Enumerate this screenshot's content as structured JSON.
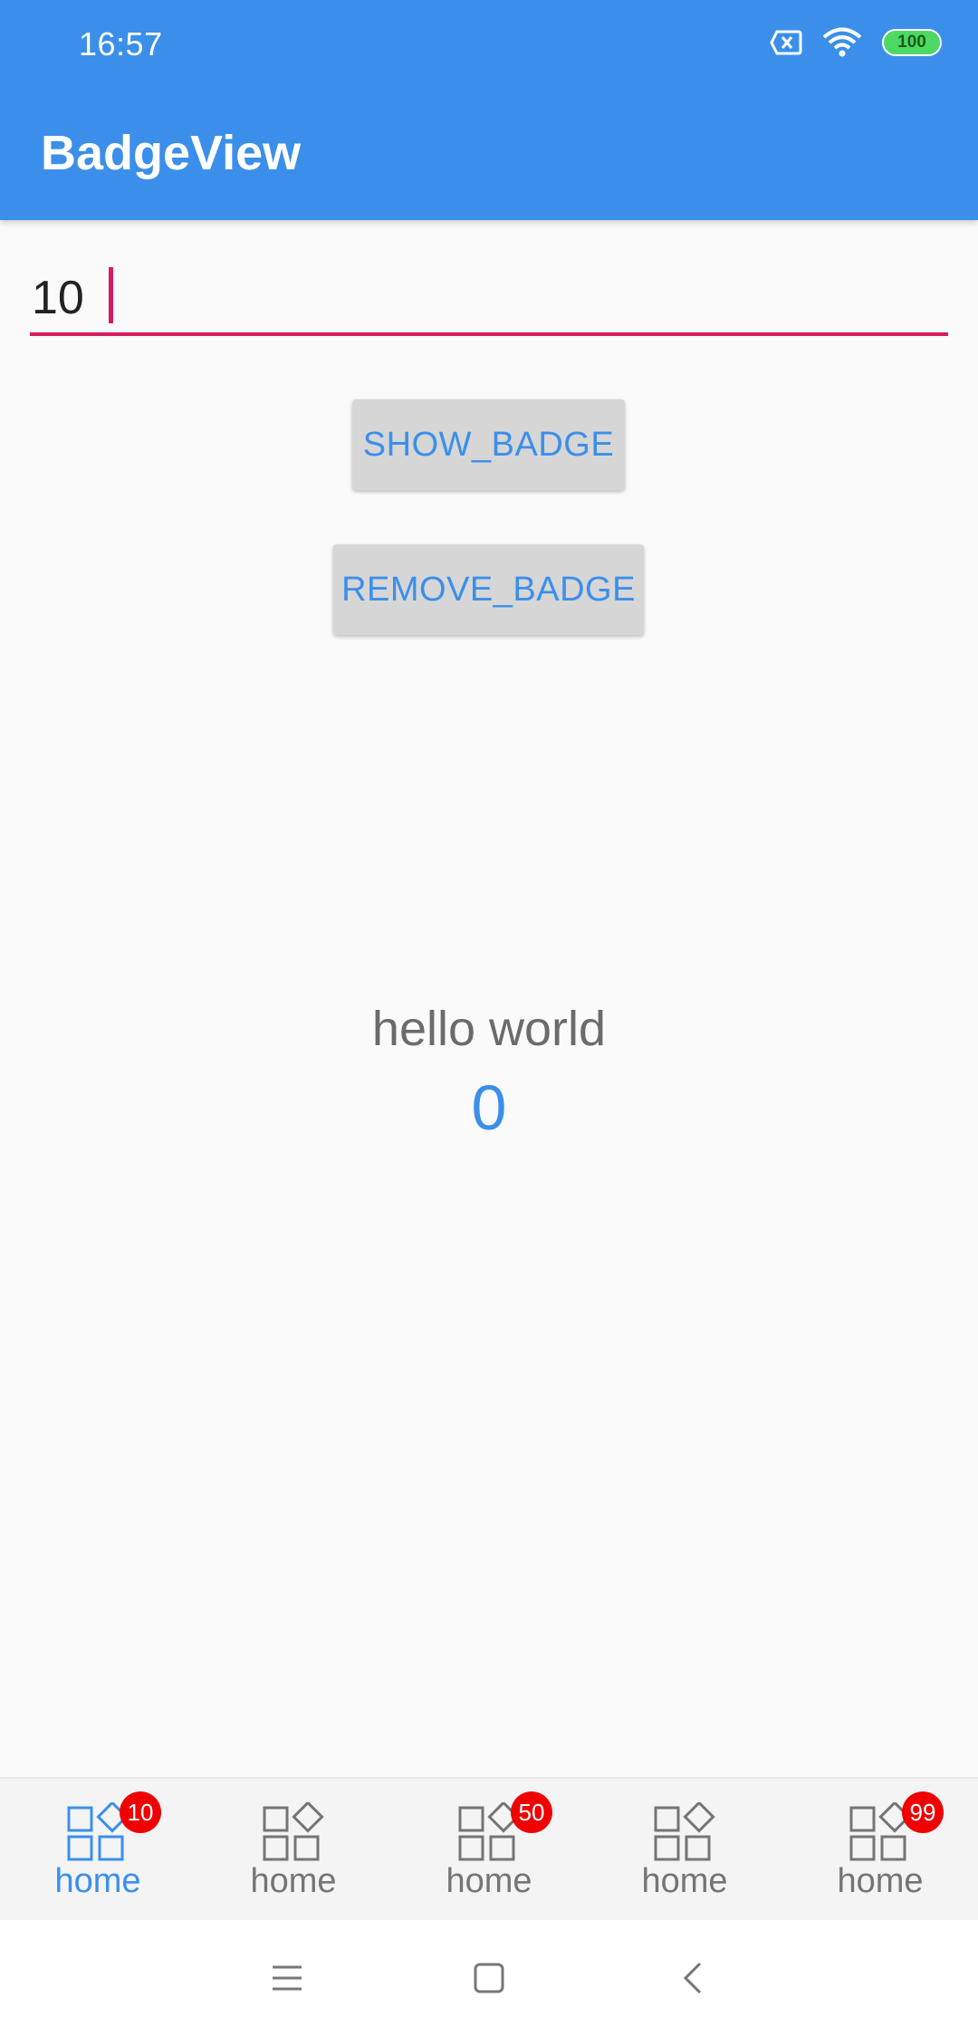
{
  "status_bar": {
    "time": "16:57",
    "battery": "100",
    "icons": [
      "sim-error-icon",
      "wifi-icon",
      "battery-icon"
    ]
  },
  "app_bar": {
    "title": "BadgeView"
  },
  "input": {
    "value": "10"
  },
  "buttons": {
    "show_badge": "SHOW_BADGE",
    "remove_badge": "REMOVE_BADGE"
  },
  "content": {
    "hello": "hello world",
    "counter": "0"
  },
  "bottom_nav": {
    "tabs": [
      {
        "label": "home",
        "badge": "10",
        "active": true
      },
      {
        "label": "home",
        "badge": "",
        "active": false
      },
      {
        "label": "home",
        "badge": "50",
        "active": false
      },
      {
        "label": "home",
        "badge": "",
        "active": false
      },
      {
        "label": "home",
        "badge": "99",
        "active": false
      }
    ]
  },
  "system_nav": {
    "icons": [
      "menu-icon",
      "home-square-icon",
      "back-chevron-icon"
    ]
  },
  "colors": {
    "primary": "#3b8fea",
    "accent": "#d81b60",
    "badge": "#f00000"
  }
}
